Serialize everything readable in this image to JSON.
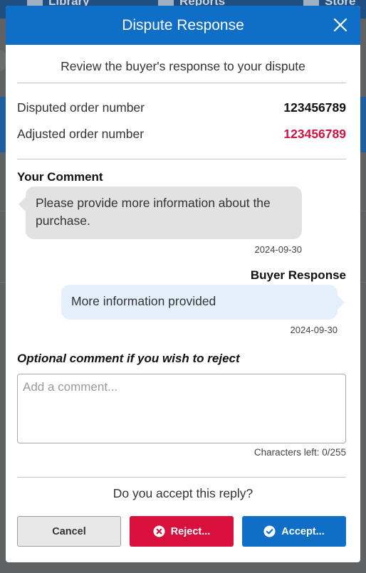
{
  "background": {
    "nav_items": [
      "Library",
      "Reports",
      "Store"
    ]
  },
  "modal": {
    "title": "Dispute Response",
    "subtitle": "Review the buyer's response to your dispute",
    "disputed_label": "Disputed order number",
    "disputed_value": "123456789",
    "adjusted_label": "Adjusted order number",
    "adjusted_value": "123456789",
    "your_comment_label": "Your Comment",
    "your_comment_text": "Please provide more information about the purchase.",
    "your_comment_date": "2024-09-30",
    "buyer_response_label": "Buyer Response",
    "buyer_response_text": "More information provided",
    "buyer_response_date": "2024-09-30",
    "optional_label": "Optional comment if you wish to reject",
    "comment_placeholder": "Add a comment...",
    "chars_left": "Characters left: 0/255",
    "question": "Do you accept this reply?",
    "cancel_label": "Cancel",
    "reject_label": "Reject...",
    "accept_label": "Accept..."
  },
  "colors": {
    "header": "#0f6fc6",
    "reject": "#d90f3c",
    "accept": "#0f6fc6",
    "adjusted_value": "#d11240"
  },
  "icons": [
    "close-icon",
    "x-circle-icon",
    "check-circle-icon"
  ]
}
